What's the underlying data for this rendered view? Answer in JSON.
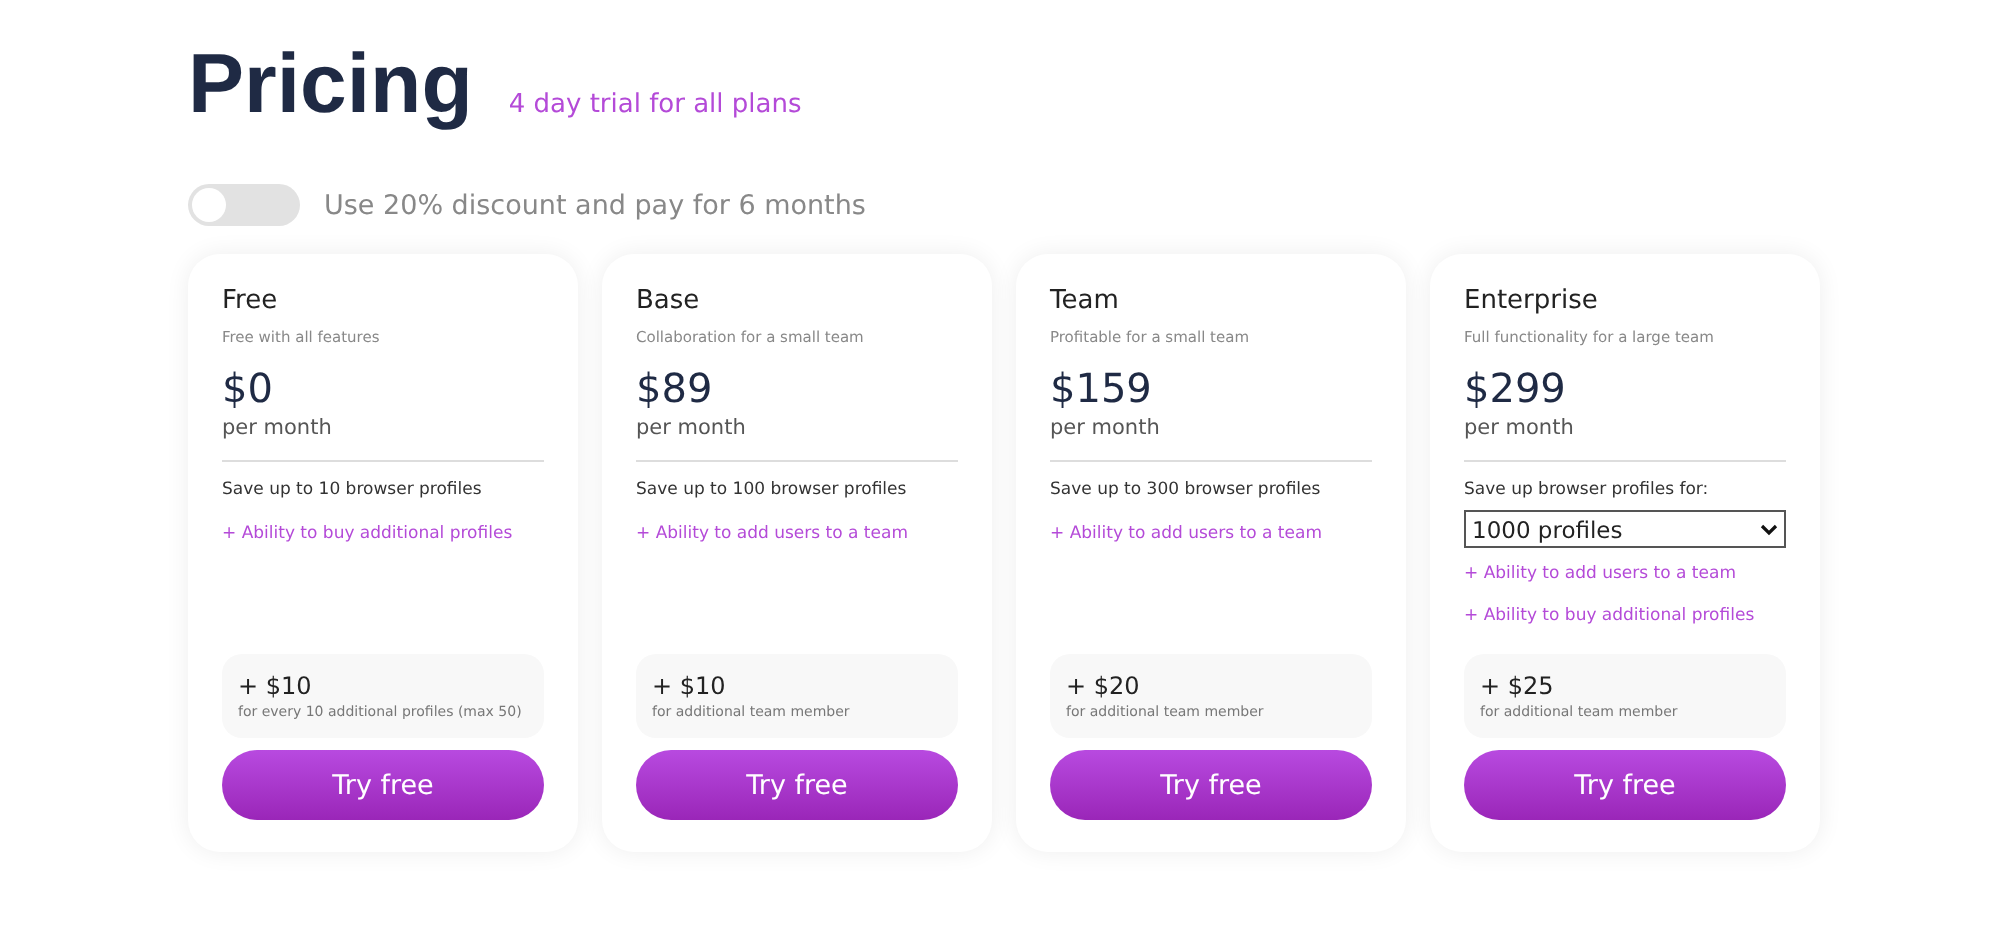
{
  "header": {
    "title": "Pricing",
    "trial_note": "4 day trial for all plans"
  },
  "discount_toggle": {
    "on": false,
    "label": "Use 20% discount and pay for 6 months"
  },
  "plans": [
    {
      "name": "Free",
      "subtitle": "Free with all features",
      "price": "$0",
      "period": "per month",
      "limit": "Save up to 10 browser profiles",
      "features": [
        "+ Ability to buy additional profiles"
      ],
      "extra_price": "+ $10",
      "extra_note": "for every 10 additional profiles (max 50)",
      "button": "Try free"
    },
    {
      "name": "Base",
      "subtitle": "Collaboration for a small team",
      "price": "$89",
      "period": "per month",
      "limit": "Save up to 100 browser profiles",
      "features": [
        "+ Ability to add users to a team"
      ],
      "extra_price": "+ $10",
      "extra_note": "for additional team member",
      "button": "Try free"
    },
    {
      "name": "Team",
      "subtitle": "Profitable for a small team",
      "price": "$159",
      "period": "per month",
      "limit": "Save up to 300 browser profiles",
      "features": [
        "+ Ability to add users to a team"
      ],
      "extra_price": "+ $20",
      "extra_note": "for additional team member",
      "button": "Try free"
    },
    {
      "name": "Enterprise",
      "subtitle": "Full functionality for a large team",
      "price": "$299",
      "period": "per month",
      "limit": "Save up browser profiles for:",
      "profile_select": {
        "value": "1000 profiles"
      },
      "features": [
        "+ Ability to add users to a team",
        "+ Ability to buy additional profiles"
      ],
      "extra_price": "+ $25",
      "extra_note": "for additional team member",
      "button": "Try free"
    }
  ]
}
